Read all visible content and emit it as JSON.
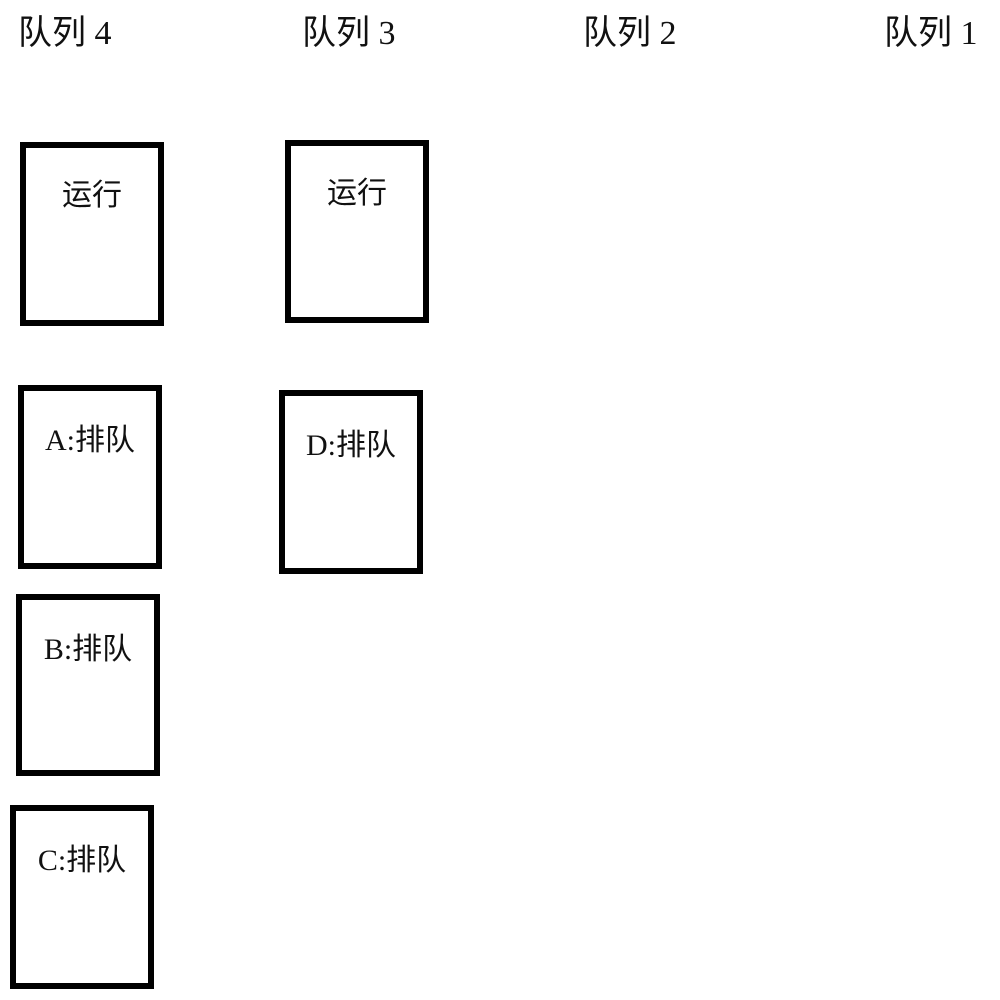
{
  "diagram": {
    "queues": [
      {
        "id": "queue-4",
        "label": "队列 4",
        "boxes": [
          {
            "label": "运行",
            "state": "running"
          },
          {
            "label": "A:排队",
            "state": "queued"
          },
          {
            "label": "B:排队",
            "state": "queued"
          },
          {
            "label": "C:排队",
            "state": "queued"
          }
        ]
      },
      {
        "id": "queue-3",
        "label": "队列 3",
        "boxes": [
          {
            "label": "运行",
            "state": "running"
          },
          {
            "label": "D:排队",
            "state": "queued"
          }
        ]
      },
      {
        "id": "queue-2",
        "label": "队列 2",
        "boxes": []
      },
      {
        "id": "queue-1",
        "label": "队列 1",
        "boxes": []
      }
    ],
    "colors": {
      "border": "#000000",
      "background": "#ffffff",
      "text": "#111111"
    }
  }
}
